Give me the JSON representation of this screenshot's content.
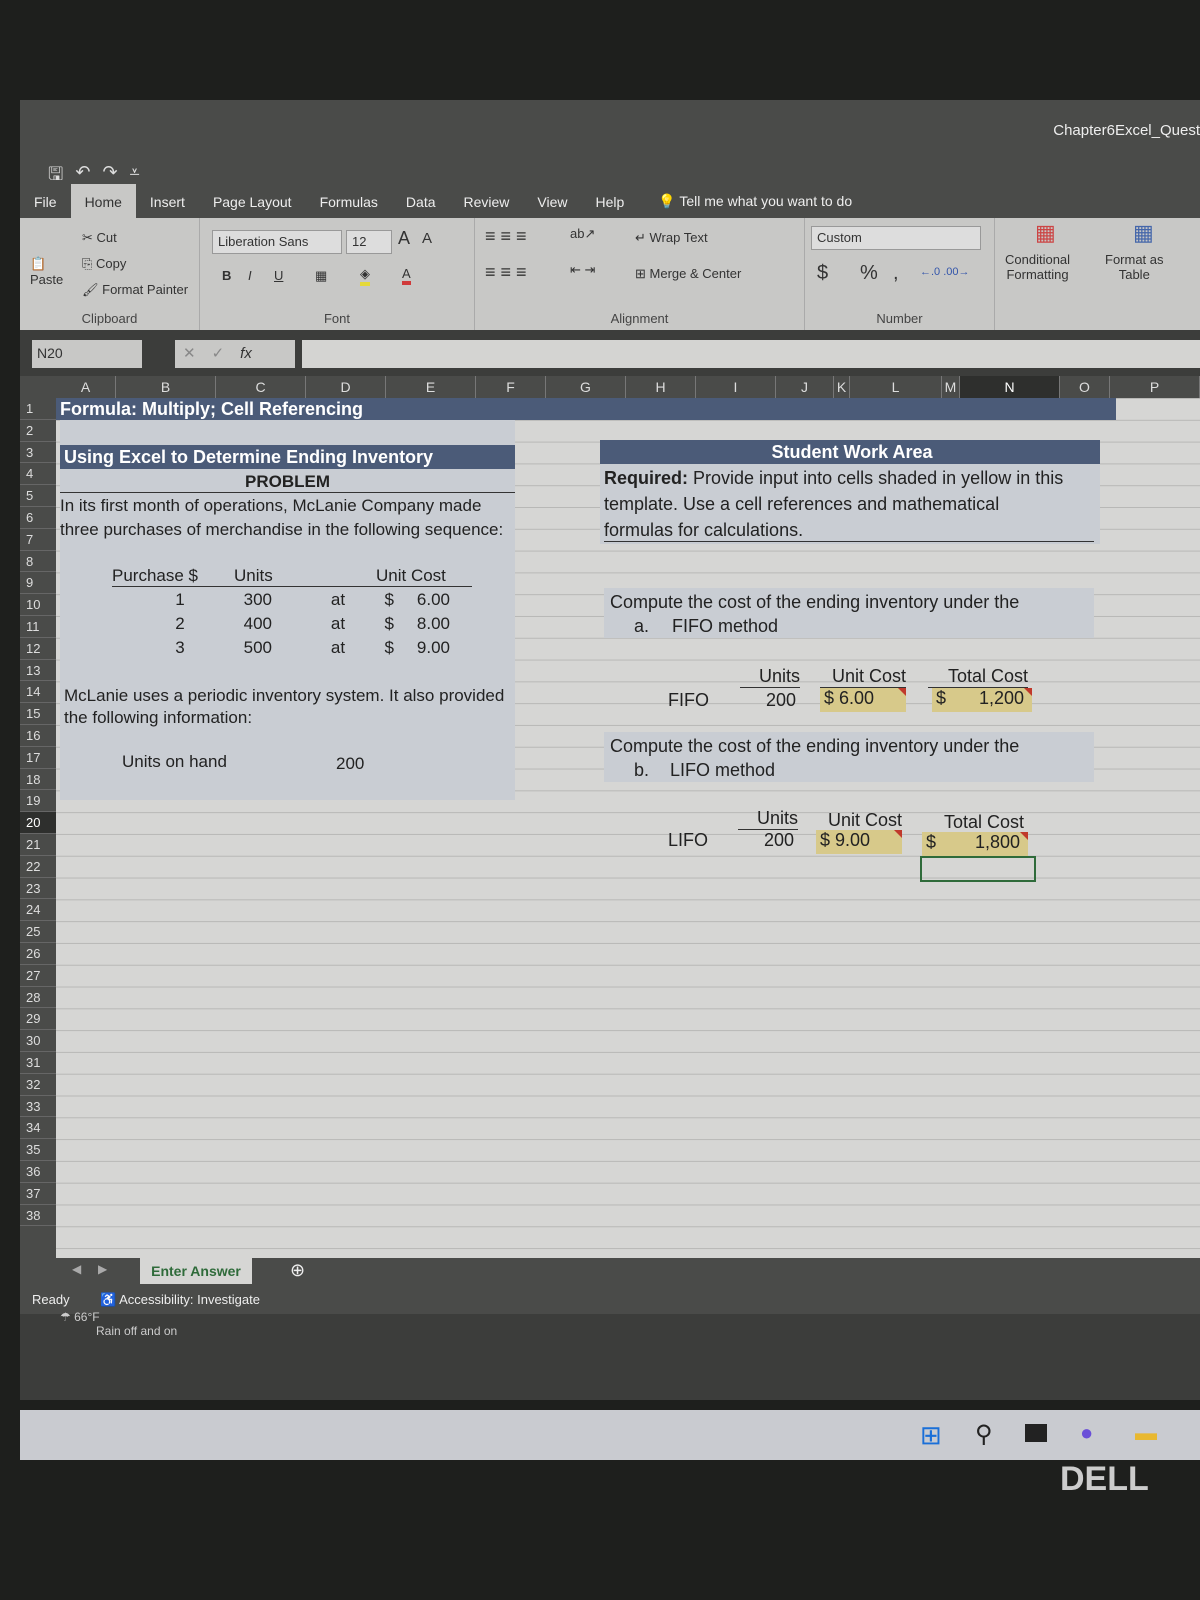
{
  "window": {
    "title": "Chapter6Excel_Quest"
  },
  "quick_access": {
    "save_icon": "save-icon",
    "undo_icon": "undo-icon",
    "redo_icon": "redo-icon",
    "customize_icon": "customize-qat-icon"
  },
  "tabs": [
    "File",
    "Home",
    "Insert",
    "Page Layout",
    "Formulas",
    "Data",
    "Review",
    "View",
    "Help"
  ],
  "active_tab": "Home",
  "tell_me": "Tell me what you want to do",
  "ribbon": {
    "clipboard": {
      "paste": "Paste",
      "cut": "Cut",
      "copy": "Copy",
      "format_painter": "Format Painter",
      "label": "Clipboard"
    },
    "font": {
      "name": "Liberation Sans",
      "size": "12",
      "grow": "A",
      "shrink": "A",
      "bold": "B",
      "italic": "I",
      "underline": "U",
      "label": "Font"
    },
    "alignment": {
      "wrap_text": "Wrap Text",
      "merge_center": "Merge & Center",
      "label": "Alignment"
    },
    "number": {
      "format": "Custom",
      "currency": "$",
      "percent": "%",
      "comma": ",",
      "label": "Number"
    },
    "styles": {
      "conditional_formatting_1": "Conditional",
      "conditional_formatting_2": "Formatting",
      "format_table_1": "Format as",
      "format_table_2": "Table"
    }
  },
  "formula_bar": {
    "name_box": "N20",
    "fx": "fx",
    "value": ""
  },
  "columns": [
    "A",
    "B",
    "C",
    "D",
    "E",
    "F",
    "G",
    "H",
    "I",
    "J",
    "K",
    "L",
    "M",
    "N",
    "O",
    "P"
  ],
  "selected_column": "N",
  "rows": [
    "1",
    "2",
    "3",
    "4",
    "5",
    "6",
    "7",
    "8",
    "9",
    "10",
    "11",
    "12",
    "13",
    "14",
    "15",
    "16",
    "17",
    "18",
    "19",
    "20",
    "21",
    "22",
    "23",
    "24",
    "25",
    "26",
    "27",
    "28",
    "29",
    "30",
    "31",
    "32",
    "33",
    "34",
    "35",
    "36",
    "37",
    "38"
  ],
  "selected_row": "20",
  "sheet": {
    "title": "Formula: Multiply; Cell Referencing",
    "section_title": "Using Excel to Determine Ending Inventory",
    "problem_label": "PROBLEM",
    "intro_line1": "In its first month of operations, McLanie Company made",
    "intro_line2": "three purchases of merchandise in the following sequence:",
    "purchase_headers": {
      "purchase": "Purchase $",
      "units": "Units",
      "unit_cost": "Unit Cost"
    },
    "purchases": [
      {
        "n": "1",
        "units": "300",
        "at": "at",
        "dollar": "$",
        "cost": "6.00"
      },
      {
        "n": "2",
        "units": "400",
        "at": "at",
        "dollar": "$",
        "cost": "8.00"
      },
      {
        "n": "3",
        "units": "500",
        "at": "at",
        "dollar": "$",
        "cost": "9.00"
      }
    ],
    "info_line1": "McLanie uses a periodic inventory system. It also provided",
    "info_line2": "the following information:",
    "units_on_hand_label": "Units on hand",
    "units_on_hand": "200",
    "student_area": {
      "title": "Student Work Area",
      "required_bold": "Required:",
      "required_line1": " Provide input into cells shaded in yellow in this",
      "required_line2": "template. Use a cell references and mathematical",
      "required_line3": "formulas for calculations.",
      "fifo": {
        "prompt": "Compute the cost of the ending inventory under the",
        "letter": "a.",
        "method": "FIFO method",
        "headers": {
          "units": "Units",
          "unit_cost": "Unit Cost",
          "total_cost": "Total Cost"
        },
        "label": "FIFO",
        "units": "200",
        "unit_cost": "$ 6.00",
        "total_dollar": "$",
        "total_cost": "1,200"
      },
      "lifo": {
        "prompt": "Compute the cost of the ending inventory under the",
        "letter": "b.",
        "method": "LIFO method",
        "headers": {
          "units": "Units",
          "unit_cost": "Unit Cost",
          "total_cost": "Total Cost"
        },
        "label": "LIFO",
        "units": "200",
        "unit_cost": "$ 9.00",
        "total_dollar": "$",
        "total_cost": "1,800"
      }
    }
  },
  "sheet_tabs": [
    {
      "label": "Enter Answer",
      "active": true
    }
  ],
  "status": {
    "ready": "Ready",
    "accessibility": "Accessibility: Investigate"
  },
  "weather": {
    "temp": "66°F",
    "desc": "Rain off and on"
  },
  "colors": {
    "header_band": "#4b5b78",
    "input_yellow": "#d7c98a",
    "active_cell": "#2f6b3a",
    "comment_marker": "#c0392b"
  }
}
